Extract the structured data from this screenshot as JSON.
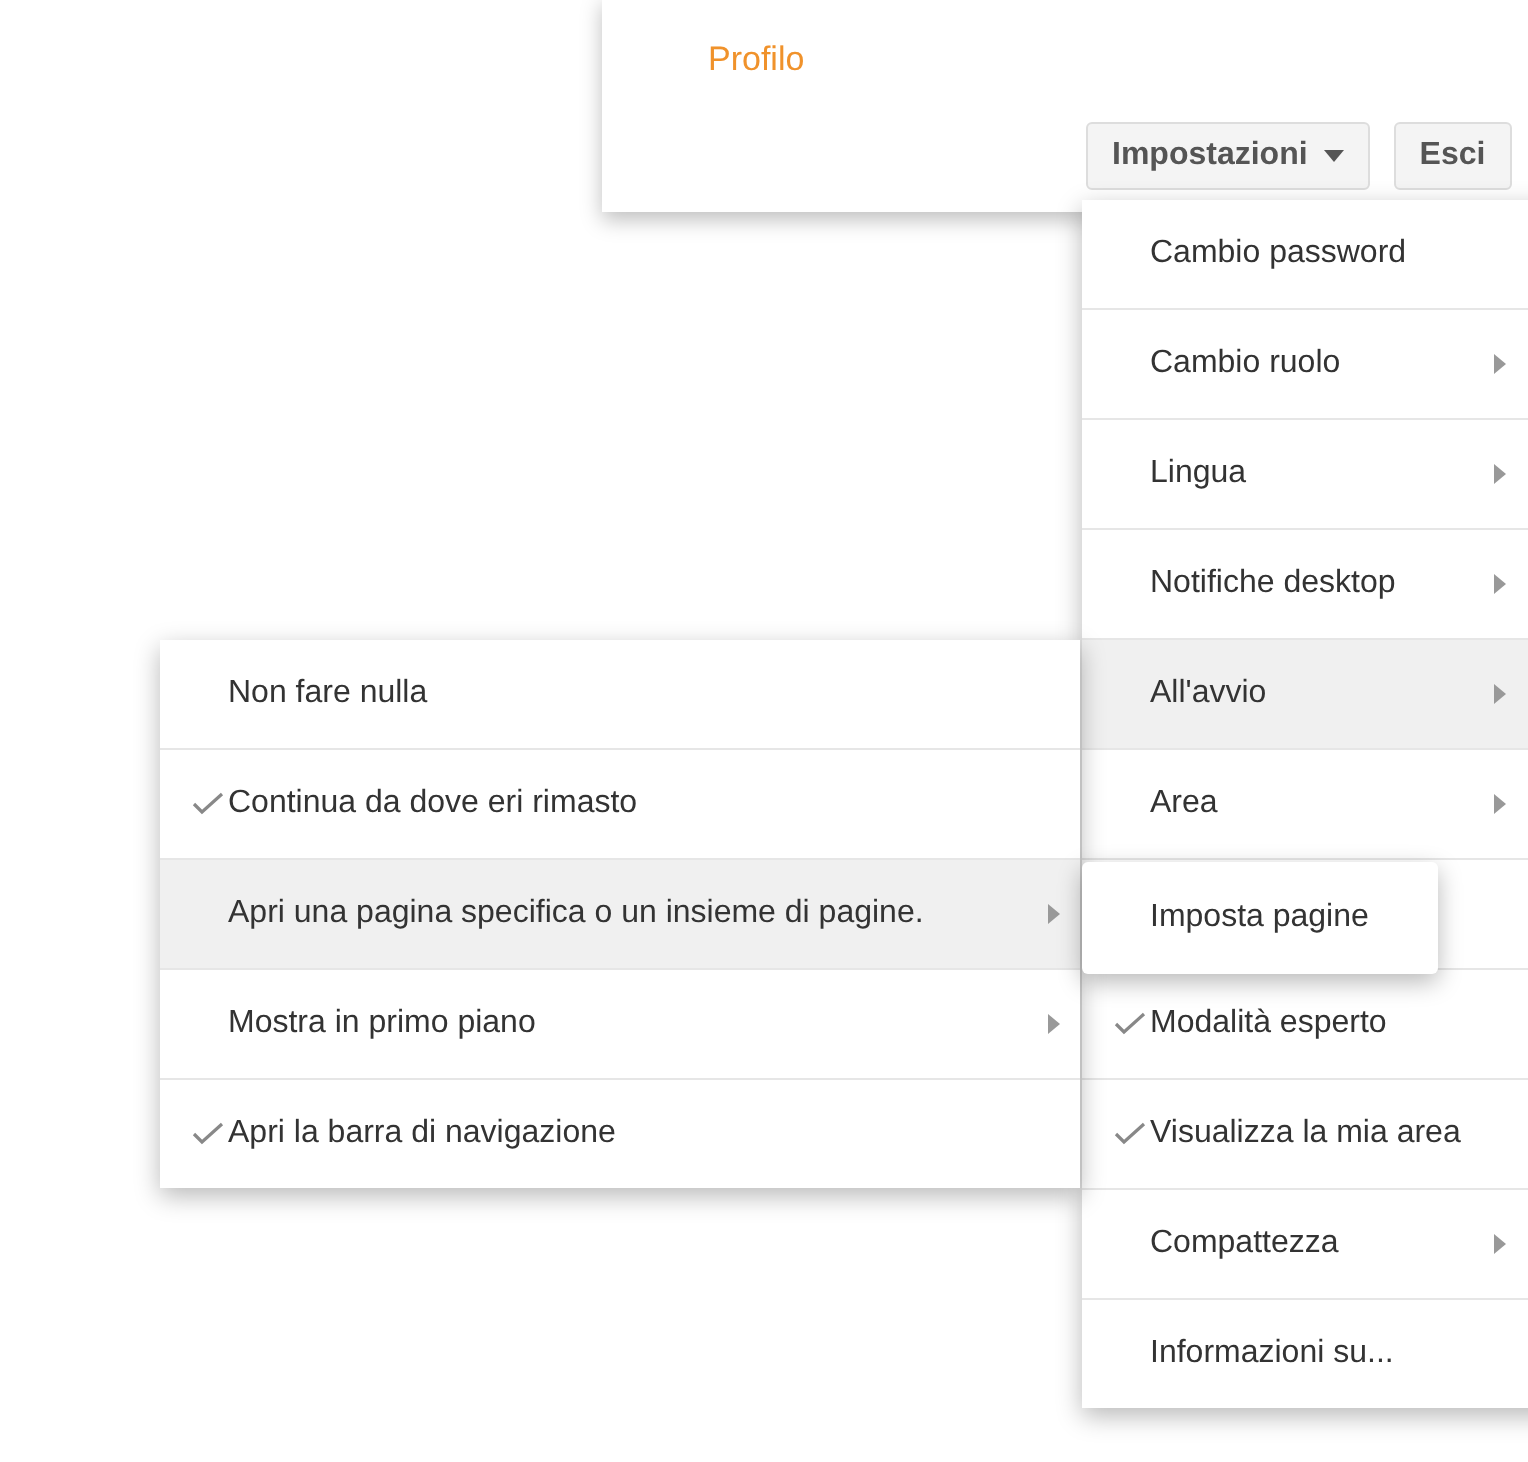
{
  "profile_panel": {
    "link": "Profilo",
    "buttons": [
      {
        "label": "Impostazioni",
        "dropdown": true
      },
      {
        "label": "Esci",
        "dropdown": false
      }
    ]
  },
  "settings_menu": {
    "items": [
      {
        "kind": "item",
        "label": "Cambio password",
        "checked": false,
        "submenu": false,
        "selected": false
      },
      {
        "kind": "item",
        "label": "Cambio ruolo",
        "checked": false,
        "submenu": true,
        "selected": false
      },
      {
        "kind": "item",
        "label": "Lingua",
        "checked": false,
        "submenu": true,
        "selected": false
      },
      {
        "kind": "item",
        "label": "Notifiche desktop",
        "checked": false,
        "submenu": true,
        "selected": false
      },
      {
        "kind": "item",
        "label": "All'avvio",
        "checked": false,
        "submenu": true,
        "selected": true
      },
      {
        "kind": "item",
        "label": "Area",
        "checked": false,
        "submenu": true,
        "selected": false
      },
      {
        "kind": "covered"
      },
      {
        "kind": "item",
        "label": "Modalità esperto",
        "checked": true,
        "submenu": false,
        "selected": false
      },
      {
        "kind": "item",
        "label": "Visualizza la mia area",
        "checked": true,
        "submenu": false,
        "selected": false
      },
      {
        "kind": "item",
        "label": "Compattezza",
        "checked": false,
        "submenu": true,
        "selected": false
      },
      {
        "kind": "item",
        "label": "Informazioni su...",
        "checked": false,
        "submenu": false,
        "selected": false
      }
    ]
  },
  "startup_menu": {
    "items": [
      {
        "label": "Non fare nulla",
        "checked": false,
        "submenu": false,
        "selected": false
      },
      {
        "label": "Continua da dove eri rimasto",
        "checked": true,
        "submenu": false,
        "selected": false
      },
      {
        "label": "Apri una pagina specifica o un insieme di pagine.",
        "checked": false,
        "submenu": true,
        "selected": true
      },
      {
        "label": "Mostra in primo piano",
        "checked": false,
        "submenu": true,
        "selected": false
      },
      {
        "label": "Apri la barra di navigazione",
        "checked": true,
        "submenu": false,
        "selected": false
      }
    ]
  },
  "pages_menu": {
    "items": [
      {
        "label": "Imposta pagine"
      }
    ]
  }
}
